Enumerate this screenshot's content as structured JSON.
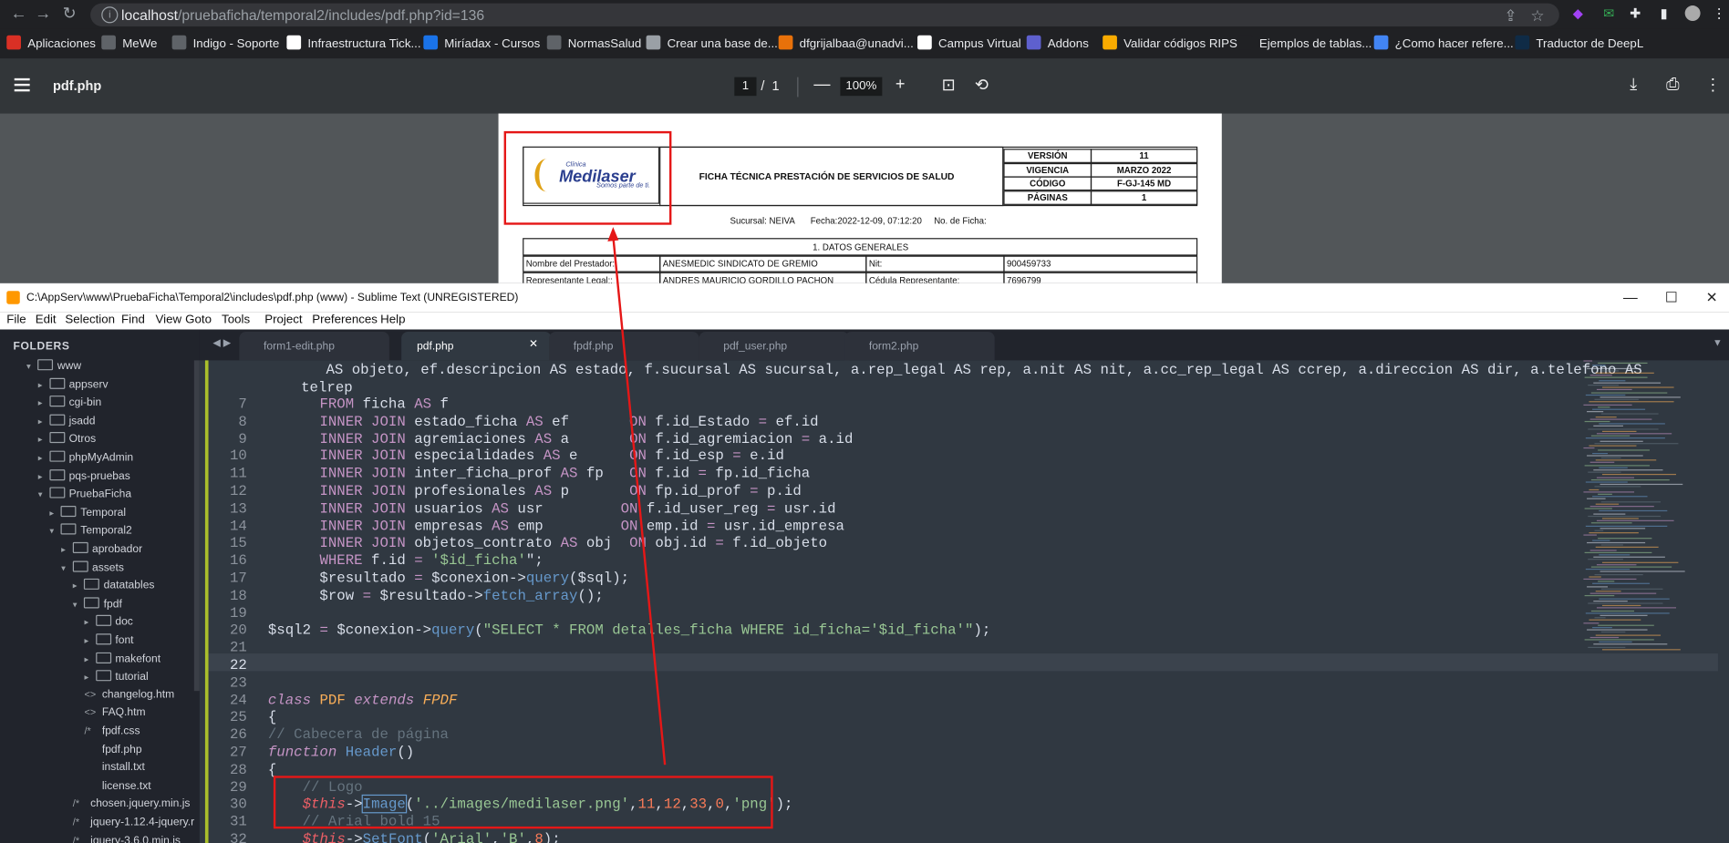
{
  "browser": {
    "url_host": "localhost",
    "url_path": "/pruebaficha/temporal2/includes/pdf.php?id=136",
    "bookmarks": [
      {
        "label": "Aplicaciones",
        "color": "#d93025"
      },
      {
        "label": "MeWe",
        "color": "#5f6368"
      },
      {
        "label": "Indigo - Soporte",
        "color": "#5f6368"
      },
      {
        "label": "Infraestructura Tick...",
        "color": "#ffffff"
      },
      {
        "label": "Miríadax - Cursos",
        "color": "#1a73e8"
      },
      {
        "label": "NormasSalud",
        "color": "#5f6368"
      },
      {
        "label": "Crear una base de...",
        "color": "#9aa0a6"
      },
      {
        "label": "dfgrijalbaa@unadvi...",
        "color": "#e8710a"
      },
      {
        "label": "Campus Virtual",
        "color": "#ffffff"
      },
      {
        "label": "Addons",
        "color": "#5e60ce"
      },
      {
        "label": "Validar códigos RIPS",
        "color": "#f9ab00"
      },
      {
        "label": "Ejemplos de tablas...",
        "color": "#202124"
      },
      {
        "label": "¿Como hacer refere...",
        "color": "#4285f4"
      },
      {
        "label": "Traductor de DeepL",
        "color": "#0f2b46"
      }
    ]
  },
  "pdf": {
    "title": "pdf.php",
    "page_current": "1",
    "page_sep": "/",
    "page_total": "1",
    "zoom": "100%",
    "logo_line1": "Clínica",
    "logo_line2": "Medilaser",
    "logo_line3": "Somos parte de ti.",
    "doc_title": "FICHA TÉCNICA PRESTACIÓN DE SERVICIOS DE SALUD",
    "meta": [
      {
        "k": "VERSIÓN",
        "v": "11"
      },
      {
        "k": "VIGENCIA",
        "v": "MARZO 2022"
      },
      {
        "k": "CÓDIGO",
        "v": "F-GJ-145 MD"
      },
      {
        "k": "PÁGINAS",
        "v": "1"
      }
    ],
    "sucursal": "Sucursal: NEIVA",
    "fecha": "Fecha:2022-12-09, 07:12:20",
    "no_ficha": "No. de Ficha:",
    "section": "1. DATOS GENERALES",
    "prestador_label": "Nombre del Prestador:",
    "prestador_value": "ANESMEDIC SINDICATO DE GREMIO",
    "nit_label": "Nit:",
    "nit_value": "900459733",
    "rep_label": "Representante Legal::",
    "rep_value": "ANDRES MAURICIO GORDILLO PACHON",
    "cedula_label": "Cédula Representante:",
    "cedula_value": "7696799"
  },
  "sublime": {
    "title": "C:\\AppServ\\www\\PruebaFicha\\Temporal2\\includes\\pdf.php (www) - Sublime Text (UNREGISTERED)",
    "menu": [
      "File",
      "Edit",
      "Selection",
      "Find",
      "View",
      "Goto",
      "Tools",
      "Project",
      "Preferences",
      "Help"
    ],
    "folders_header": "FOLDERS",
    "tabs": [
      "form1-edit.php",
      "pdf.php",
      "fpdf.php",
      "pdf_user.php",
      "form2.php"
    ],
    "tree": [
      {
        "label": "www",
        "type": "folder",
        "depth": 0,
        "open": true
      },
      {
        "label": "appserv",
        "type": "folder",
        "depth": 1
      },
      {
        "label": "cgi-bin",
        "type": "folder",
        "depth": 1
      },
      {
        "label": "jsadd",
        "type": "folder",
        "depth": 1
      },
      {
        "label": "Otros",
        "type": "folder",
        "depth": 1
      },
      {
        "label": "phpMyAdmin",
        "type": "folder",
        "depth": 1
      },
      {
        "label": "pqs-pruebas",
        "type": "folder",
        "depth": 1
      },
      {
        "label": "PruebaFicha",
        "type": "folder",
        "depth": 1,
        "open": true
      },
      {
        "label": "Temporal",
        "type": "folder",
        "depth": 2
      },
      {
        "label": "Temporal2",
        "type": "folder",
        "depth": 2,
        "open": true
      },
      {
        "label": "aprobador",
        "type": "folder",
        "depth": 3
      },
      {
        "label": "assets",
        "type": "folder",
        "depth": 3,
        "open": true
      },
      {
        "label": "datatables",
        "type": "folder",
        "depth": 4
      },
      {
        "label": "fpdf",
        "type": "folder",
        "depth": 4,
        "open": true
      },
      {
        "label": "doc",
        "type": "folder",
        "depth": 5
      },
      {
        "label": "font",
        "type": "folder",
        "depth": 5
      },
      {
        "label": "makefont",
        "type": "folder",
        "depth": 5
      },
      {
        "label": "tutorial",
        "type": "folder",
        "depth": 5
      },
      {
        "label": "changelog.htm",
        "type": "file",
        "icon": "<>",
        "depth": 5
      },
      {
        "label": "FAQ.htm",
        "type": "file",
        "icon": "<>",
        "depth": 5
      },
      {
        "label": "fpdf.css",
        "type": "file",
        "icon": "/*",
        "depth": 5
      },
      {
        "label": "fpdf.php",
        "type": "file",
        "icon": "",
        "depth": 5
      },
      {
        "label": "install.txt",
        "type": "file",
        "icon": "",
        "depth": 5
      },
      {
        "label": "license.txt",
        "type": "file",
        "icon": "",
        "depth": 5
      },
      {
        "label": "chosen.jquery.min.js",
        "type": "file",
        "icon": "/*",
        "depth": 4
      },
      {
        "label": "jquery-1.12.4-jquery.r",
        "type": "file",
        "icon": "/*",
        "depth": 4
      },
      {
        "label": "jquery-3.6.0.min.js",
        "type": "file",
        "icon": "/*",
        "depth": 4
      }
    ],
    "code_top": [
      "  AS objeto, ef.descripcion AS estado, f.sucursal AS sucursal, a.rep_legal AS rep, a.nit AS nit, a.cc_rep_legal AS ccrep, a.direccion AS dir, a.telefono AS",
      "telrep"
    ],
    "line_numbers": [
      "7",
      "8",
      "9",
      "10",
      "11",
      "12",
      "13",
      "14",
      "15",
      "16",
      "17",
      "18",
      "19",
      "20",
      "21",
      "22",
      "23",
      "24",
      "25",
      "26",
      "27",
      "28",
      "29",
      "30",
      "31",
      "32"
    ]
  },
  "colors": {
    "annotation_red": "#e51717",
    "editor_bg": "#303841",
    "sidebar_bg": "#21242c"
  }
}
